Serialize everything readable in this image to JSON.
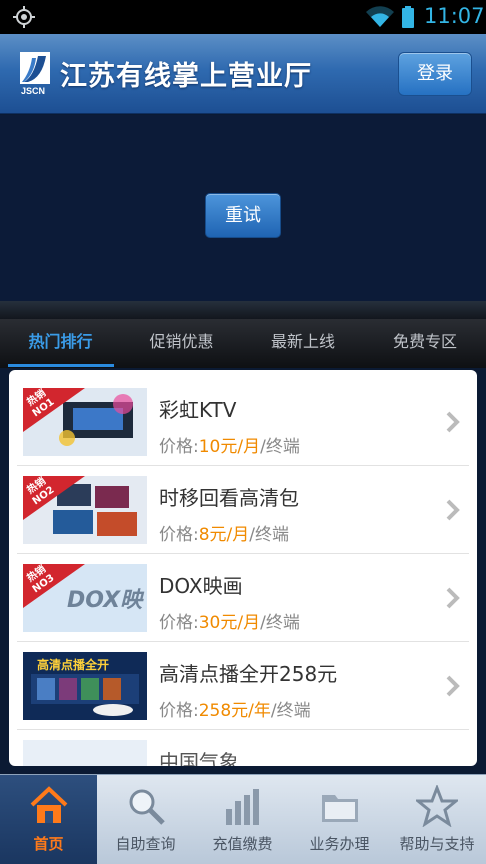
{
  "status_bar": {
    "time": "11:07"
  },
  "header": {
    "title": "江苏有线掌上营业厅",
    "logo_text": "JSCN",
    "login_label": "登录"
  },
  "banner": {
    "retry_label": "重试"
  },
  "tabs": [
    {
      "label": "热门排行",
      "active": true
    },
    {
      "label": "促销优惠",
      "active": false
    },
    {
      "label": "最新上线",
      "active": false
    },
    {
      "label": "免费专区",
      "active": false
    }
  ],
  "products": [
    {
      "title": "彩虹KTV",
      "price_label": "价格:",
      "price_value": "10元/月",
      "price_unit": "/终端",
      "badge": "热销NO1",
      "thumb_text": ""
    },
    {
      "title": "时移回看高清包",
      "price_label": "价格:",
      "price_value": "8元/月",
      "price_unit": "/终端",
      "badge": "热销NO2",
      "thumb_text": ""
    },
    {
      "title": "DOX映画",
      "price_label": "价格:",
      "price_value": "30元/月",
      "price_unit": "/终端",
      "badge": "热销NO3",
      "thumb_text": "DOX映"
    },
    {
      "title": "高清点播全开258元",
      "price_label": "价格:",
      "price_value": "258元/年",
      "price_unit": "/终端",
      "badge": "",
      "thumb_text": "高清点播全开"
    },
    {
      "title": "中国气象",
      "price_label": "",
      "price_value": "",
      "price_unit": "",
      "badge": "",
      "thumb_text": ""
    }
  ],
  "bottom_nav": [
    {
      "label": "首页",
      "icon": "home-icon",
      "active": true
    },
    {
      "label": "自助查询",
      "icon": "search-icon",
      "active": false
    },
    {
      "label": "充值缴费",
      "icon": "bar-chart-icon",
      "active": false
    },
    {
      "label": "业务办理",
      "icon": "folder-icon",
      "active": false
    },
    {
      "label": "帮助与支持",
      "icon": "star-icon",
      "active": false
    }
  ],
  "colors": {
    "accent": "#2a8be0",
    "price": "#f08a00",
    "nav_active": "#ff7a1a",
    "header": "#2f6ab0"
  }
}
